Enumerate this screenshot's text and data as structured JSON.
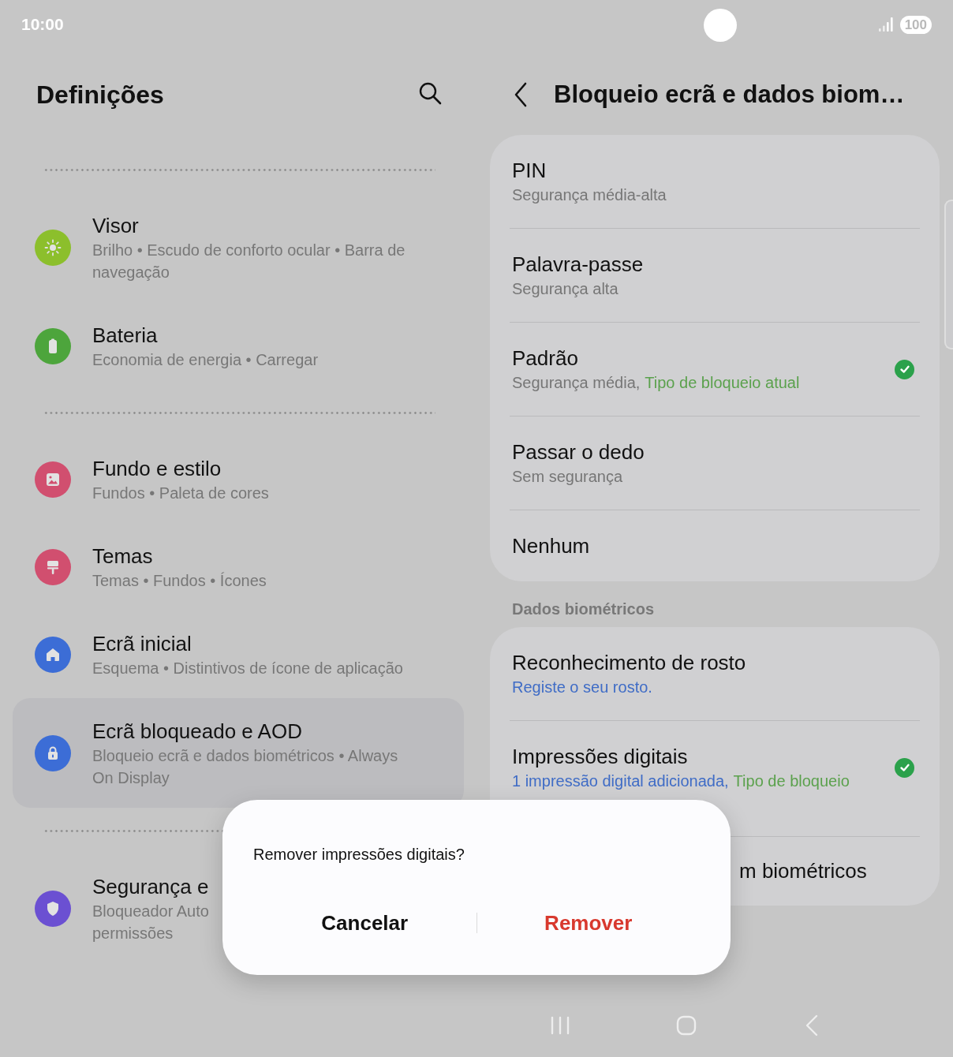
{
  "status_bar": {
    "time": "10:00",
    "battery": "100"
  },
  "left_pane": {
    "title": "Definições",
    "groups": [
      {
        "items": [
          {
            "title": "Visor",
            "subtitle_lines": [
              "Brilho • Escudo de conforto ocular • Barra de",
              "navegação"
            ],
            "color": "#8cbf2c",
            "selected": false
          },
          {
            "title": "Bateria",
            "subtitle_lines": [
              "Economia de energia • Carregar"
            ],
            "color": "#4da53c",
            "selected": false
          }
        ]
      },
      {
        "items": [
          {
            "title": "Fundo e estilo",
            "subtitle_lines": [
              "Fundos • Paleta de cores"
            ],
            "color": "#d14f6f",
            "selected": false
          },
          {
            "title": "Temas",
            "subtitle_lines": [
              "Temas • Fundos • Ícones"
            ],
            "color": "#d14f6f",
            "selected": false
          },
          {
            "title": "Ecrã inicial",
            "subtitle_lines": [
              "Esquema • Distintivos de ícone de aplicação"
            ],
            "color": "#3c6dd6",
            "selected": false
          },
          {
            "title": "Ecrã bloqueado e AOD",
            "subtitle_lines": [
              "Bloqueio ecrã e dados biométricos • Always",
              "On Display"
            ],
            "color": "#3c6dd6",
            "selected": true
          }
        ]
      },
      {
        "items": [
          {
            "title": "Segurança e",
            "subtitle_lines": [
              "Bloqueador Auto",
              "permissões"
            ],
            "color": "#6b50d2",
            "selected": false
          }
        ]
      }
    ]
  },
  "right_pane": {
    "title": "Bloqueio ecrã e dados biom…",
    "sections": [
      {
        "rows": [
          {
            "kind": "option",
            "title": "PIN",
            "subtitle": [
              {
                "text": "Segurança média-alta",
                "kind": "muted"
              }
            ],
            "checked": false
          },
          {
            "kind": "option",
            "title": "Palavra-passe",
            "subtitle": [
              {
                "text": "Segurança alta",
                "kind": "muted"
              }
            ],
            "checked": false
          },
          {
            "kind": "option",
            "title": "Padrão",
            "subtitle": [
              {
                "text": "Segurança média,",
                "kind": "muted"
              },
              {
                "text": "Tipo de bloqueio atual",
                "kind": "positive"
              }
            ],
            "checked": true
          },
          {
            "kind": "option",
            "title": "Passar o dedo",
            "subtitle": [
              {
                "text": "Sem segurança",
                "kind": "muted"
              }
            ],
            "checked": false
          },
          {
            "kind": "option",
            "title": "Nenhum",
            "checked": false
          }
        ]
      },
      {
        "header": "Dados biométricos",
        "rows": [
          {
            "kind": "option",
            "title": "Reconhecimento de rosto",
            "subtitle": [
              {
                "text": "Registe o seu rosto.",
                "kind": "link"
              }
            ],
            "checked": false
          },
          {
            "kind": "option",
            "title": "Impressões digitais",
            "subtitle": [
              {
                "text": "1 impressão digital adicionada,",
                "kind": "link"
              },
              {
                "text": "Tipo de bloqueio",
                "kind": "positive"
              }
            ],
            "checked": true
          },
          {
            "kind": "partly_hidden",
            "title": "m biométricos",
            "checked": false
          }
        ]
      }
    ]
  },
  "dialog": {
    "message": "Remover impressões digitais?",
    "buttons": [
      {
        "label": "Cancelar",
        "kind": "neutral"
      },
      {
        "label": "Remover",
        "kind": "destructive"
      }
    ]
  }
}
